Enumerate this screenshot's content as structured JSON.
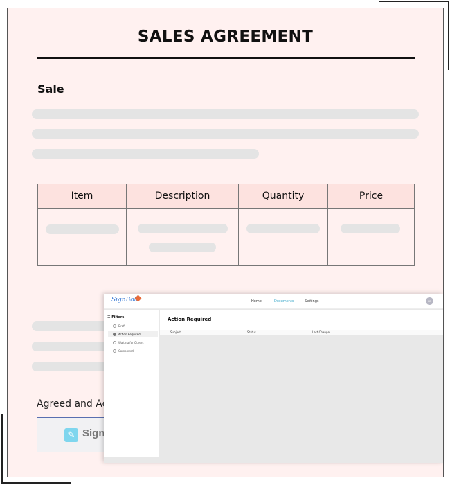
{
  "document": {
    "title": "SALES AGREEMENT",
    "section_title": "Sale",
    "table": {
      "headers": [
        "Item",
        "Description",
        "Quantity",
        "Price"
      ]
    },
    "agreed_text": "Agreed and Acc",
    "sign_button_label": "Sign",
    "sign_icon": "pen-edit-icon"
  },
  "app": {
    "logo_text": "SignBolt",
    "nav": {
      "home": "Home",
      "documents": "Documents",
      "settings": "Settings"
    },
    "avatar_initials": "KD",
    "sidebar": {
      "heading": "Filters",
      "items": [
        {
          "label": "Draft",
          "active": false
        },
        {
          "label": "Action Required",
          "active": true
        },
        {
          "label": "Waiting for Others",
          "active": false
        },
        {
          "label": "Completed",
          "active": false
        }
      ]
    },
    "main": {
      "title": "Action Required",
      "columns": [
        "Subject",
        "Status",
        "Last Change"
      ]
    }
  },
  "colors": {
    "page_bg": "#fff1f0",
    "table_header_bg": "#fde2df",
    "skeleton": "#e4e4e4",
    "accent": "#3aa7c9"
  }
}
